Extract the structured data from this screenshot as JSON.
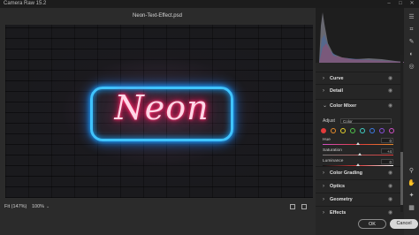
{
  "app": {
    "title": "Camera Raw 15.2"
  },
  "document": {
    "filename": "Neon-Text-Effect.psd"
  },
  "canvas": {
    "neon_text": "Neon",
    "neon_text_color": "#ff2d6f",
    "neon_border_color": "#2ab8ff"
  },
  "bottombar": {
    "fit_label": "Fit (147%)",
    "zoom_label": "100%"
  },
  "panel": {
    "sections_top": [
      {
        "label": "Curve"
      },
      {
        "label": "Detail"
      }
    ],
    "color_mixer": {
      "label": "Color Mixer",
      "adjust_label": "Adjust",
      "adjust_value": "Color",
      "swatch_colors": [
        "#e23b3b",
        "#e58a2a",
        "#e6d12c",
        "#4fc34a",
        "#3fd0c6",
        "#3c7be6",
        "#8a4fe0",
        "#d14fc5"
      ],
      "sliders": [
        {
          "label": "Hue",
          "value": "0",
          "level": 0.5
        },
        {
          "label": "Saturation",
          "value": "+4",
          "level": 0.53
        },
        {
          "label": "Luminance",
          "value": "0",
          "level": 0.5
        }
      ]
    },
    "sections_bottom": [
      {
        "label": "Color Grading"
      },
      {
        "label": "Optics"
      },
      {
        "label": "Geometry"
      },
      {
        "label": "Effects"
      }
    ]
  },
  "buttons": {
    "ok": "OK",
    "cancel": "Cancel"
  }
}
